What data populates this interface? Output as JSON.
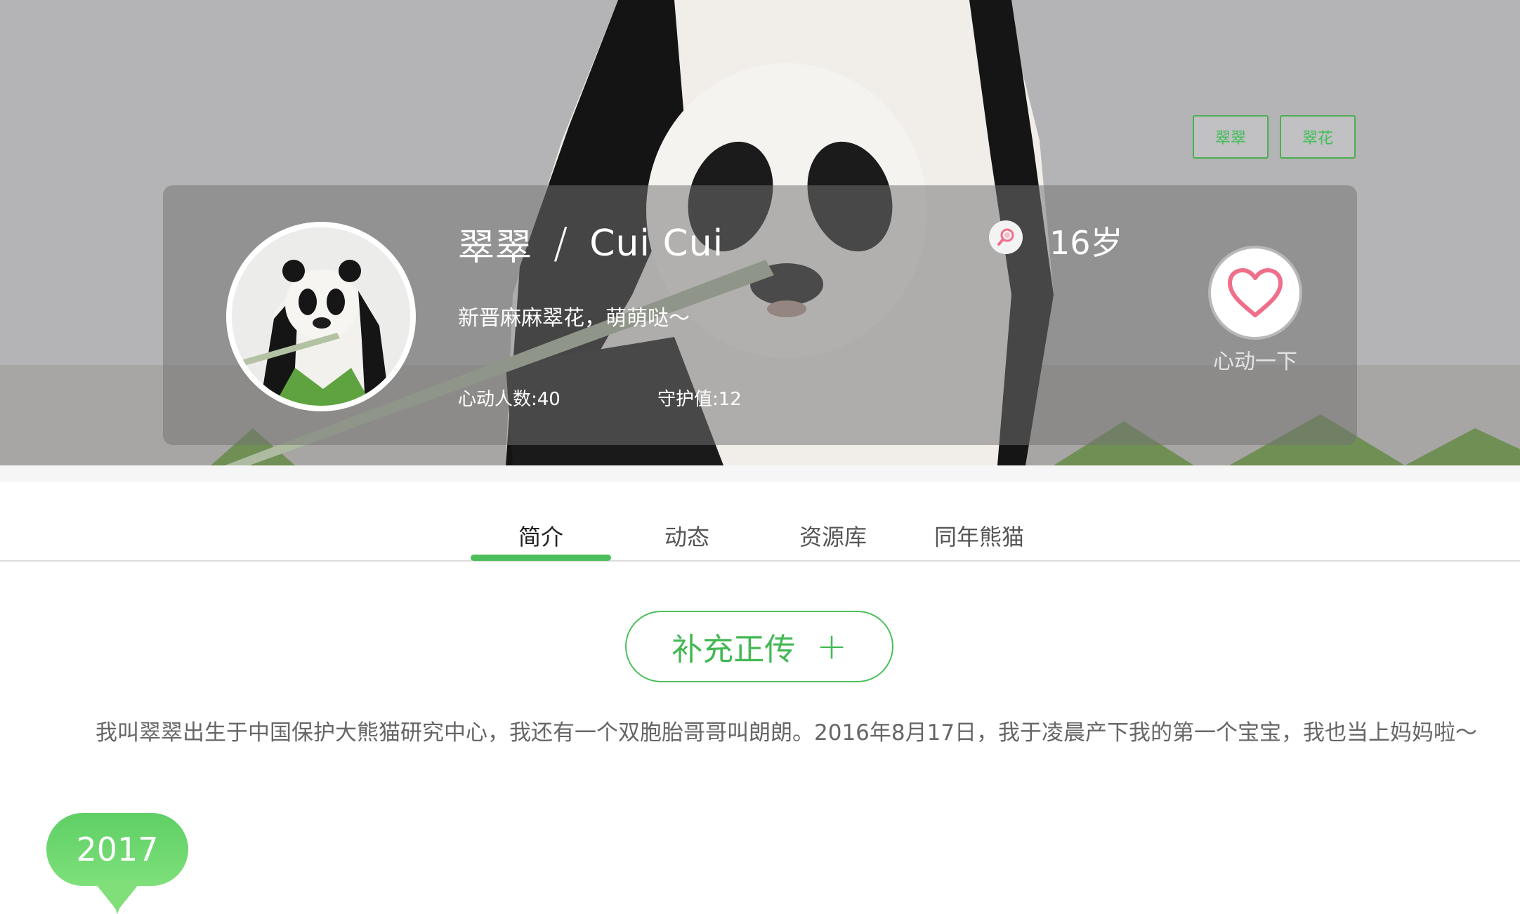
{
  "tags": [
    "翠翠",
    "翠花"
  ],
  "profile": {
    "name_cn": "翠翠",
    "separator": "/",
    "name_en": "Cui Cui",
    "motto": "新晋麻麻翠花，萌萌哒～",
    "stats": {
      "likes": "心动人数:40",
      "guard": "守护值:12"
    },
    "age": "16岁",
    "like_label": "心动一下"
  },
  "tabs": [
    "简介",
    "动态",
    "资源库",
    "同年熊猫"
  ],
  "active_tab": "简介",
  "add_bio": {
    "label": "补充正传",
    "plus": "+"
  },
  "intro": "我叫翠翠出生于中国保护大熊猫研究中心，我还有一个双胞胎哥哥叫朗朗。2016年8月17日，我于凌晨产下我的第一个宝宝，我也当上妈妈啦～",
  "timeline": {
    "year": "2017"
  },
  "colors": {
    "accent": "#4cbf5c",
    "heart": "#ef6f8a"
  },
  "icons": {
    "age": "search-pin-icon",
    "like": "heart-icon"
  }
}
